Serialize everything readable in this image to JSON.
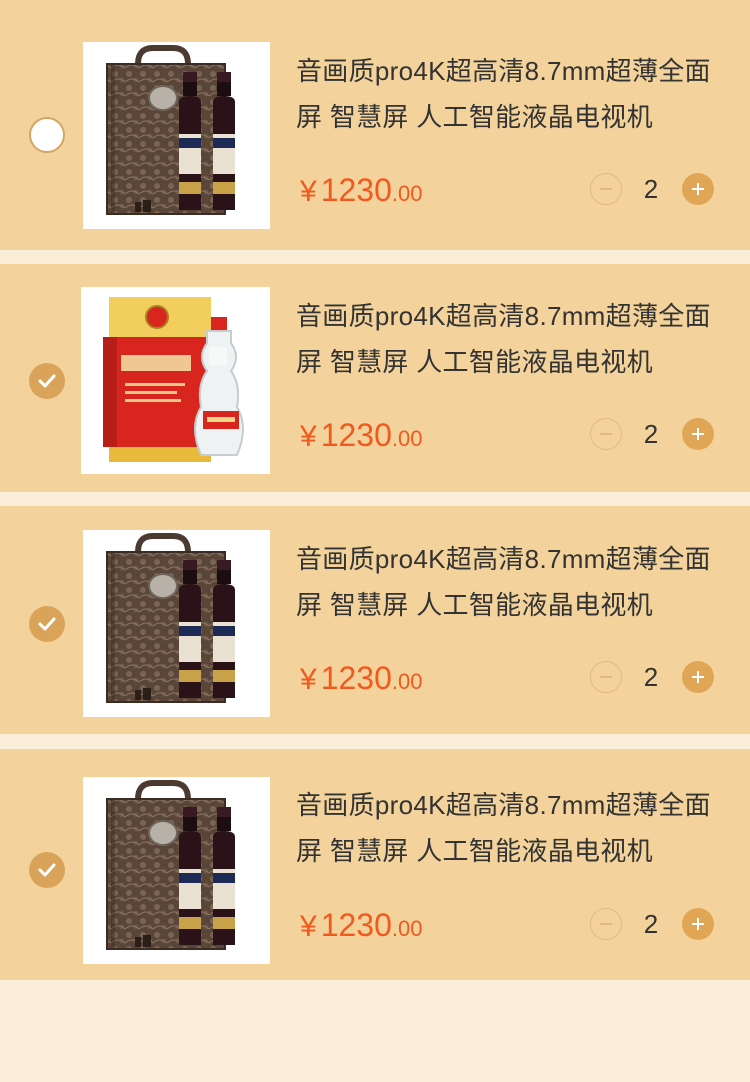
{
  "colors": {
    "card_bg": "#f3d39b",
    "page_bg": "#fbeed8",
    "price": "#f2591f",
    "accent": "#d9a45a"
  },
  "cart_items": [
    {
      "selected": false,
      "image": "wine-gift-box",
      "title": "音画质pro4K超高清8.7mm超薄全面屏 智慧屏 人工智能液晶电视机",
      "price_symbol": "¥",
      "price_int": "1230",
      "price_dec": ".00",
      "quantity": "2"
    },
    {
      "selected": true,
      "image": "baijiu-red-box",
      "title": "音画质pro4K超高清8.7mm超薄全面屏 智慧屏 人工智能液晶电视机",
      "price_symbol": "¥",
      "price_int": "1230",
      "price_dec": ".00",
      "quantity": "2"
    },
    {
      "selected": true,
      "image": "wine-gift-box",
      "title": "音画质pro4K超高清8.7mm超薄全面屏 智慧屏 人工智能液晶电视机",
      "price_symbol": "¥",
      "price_int": "1230",
      "price_dec": ".00",
      "quantity": "2"
    },
    {
      "selected": true,
      "image": "wine-gift-box",
      "title": "音画质pro4K超高清8.7mm超薄全面屏 智慧屏 人工智能液晶电视机",
      "price_symbol": "¥",
      "price_int": "1230",
      "price_dec": ".00",
      "quantity": "2"
    }
  ],
  "icons": {
    "check": "check-icon",
    "minus": "minus-icon",
    "plus": "plus-icon"
  }
}
